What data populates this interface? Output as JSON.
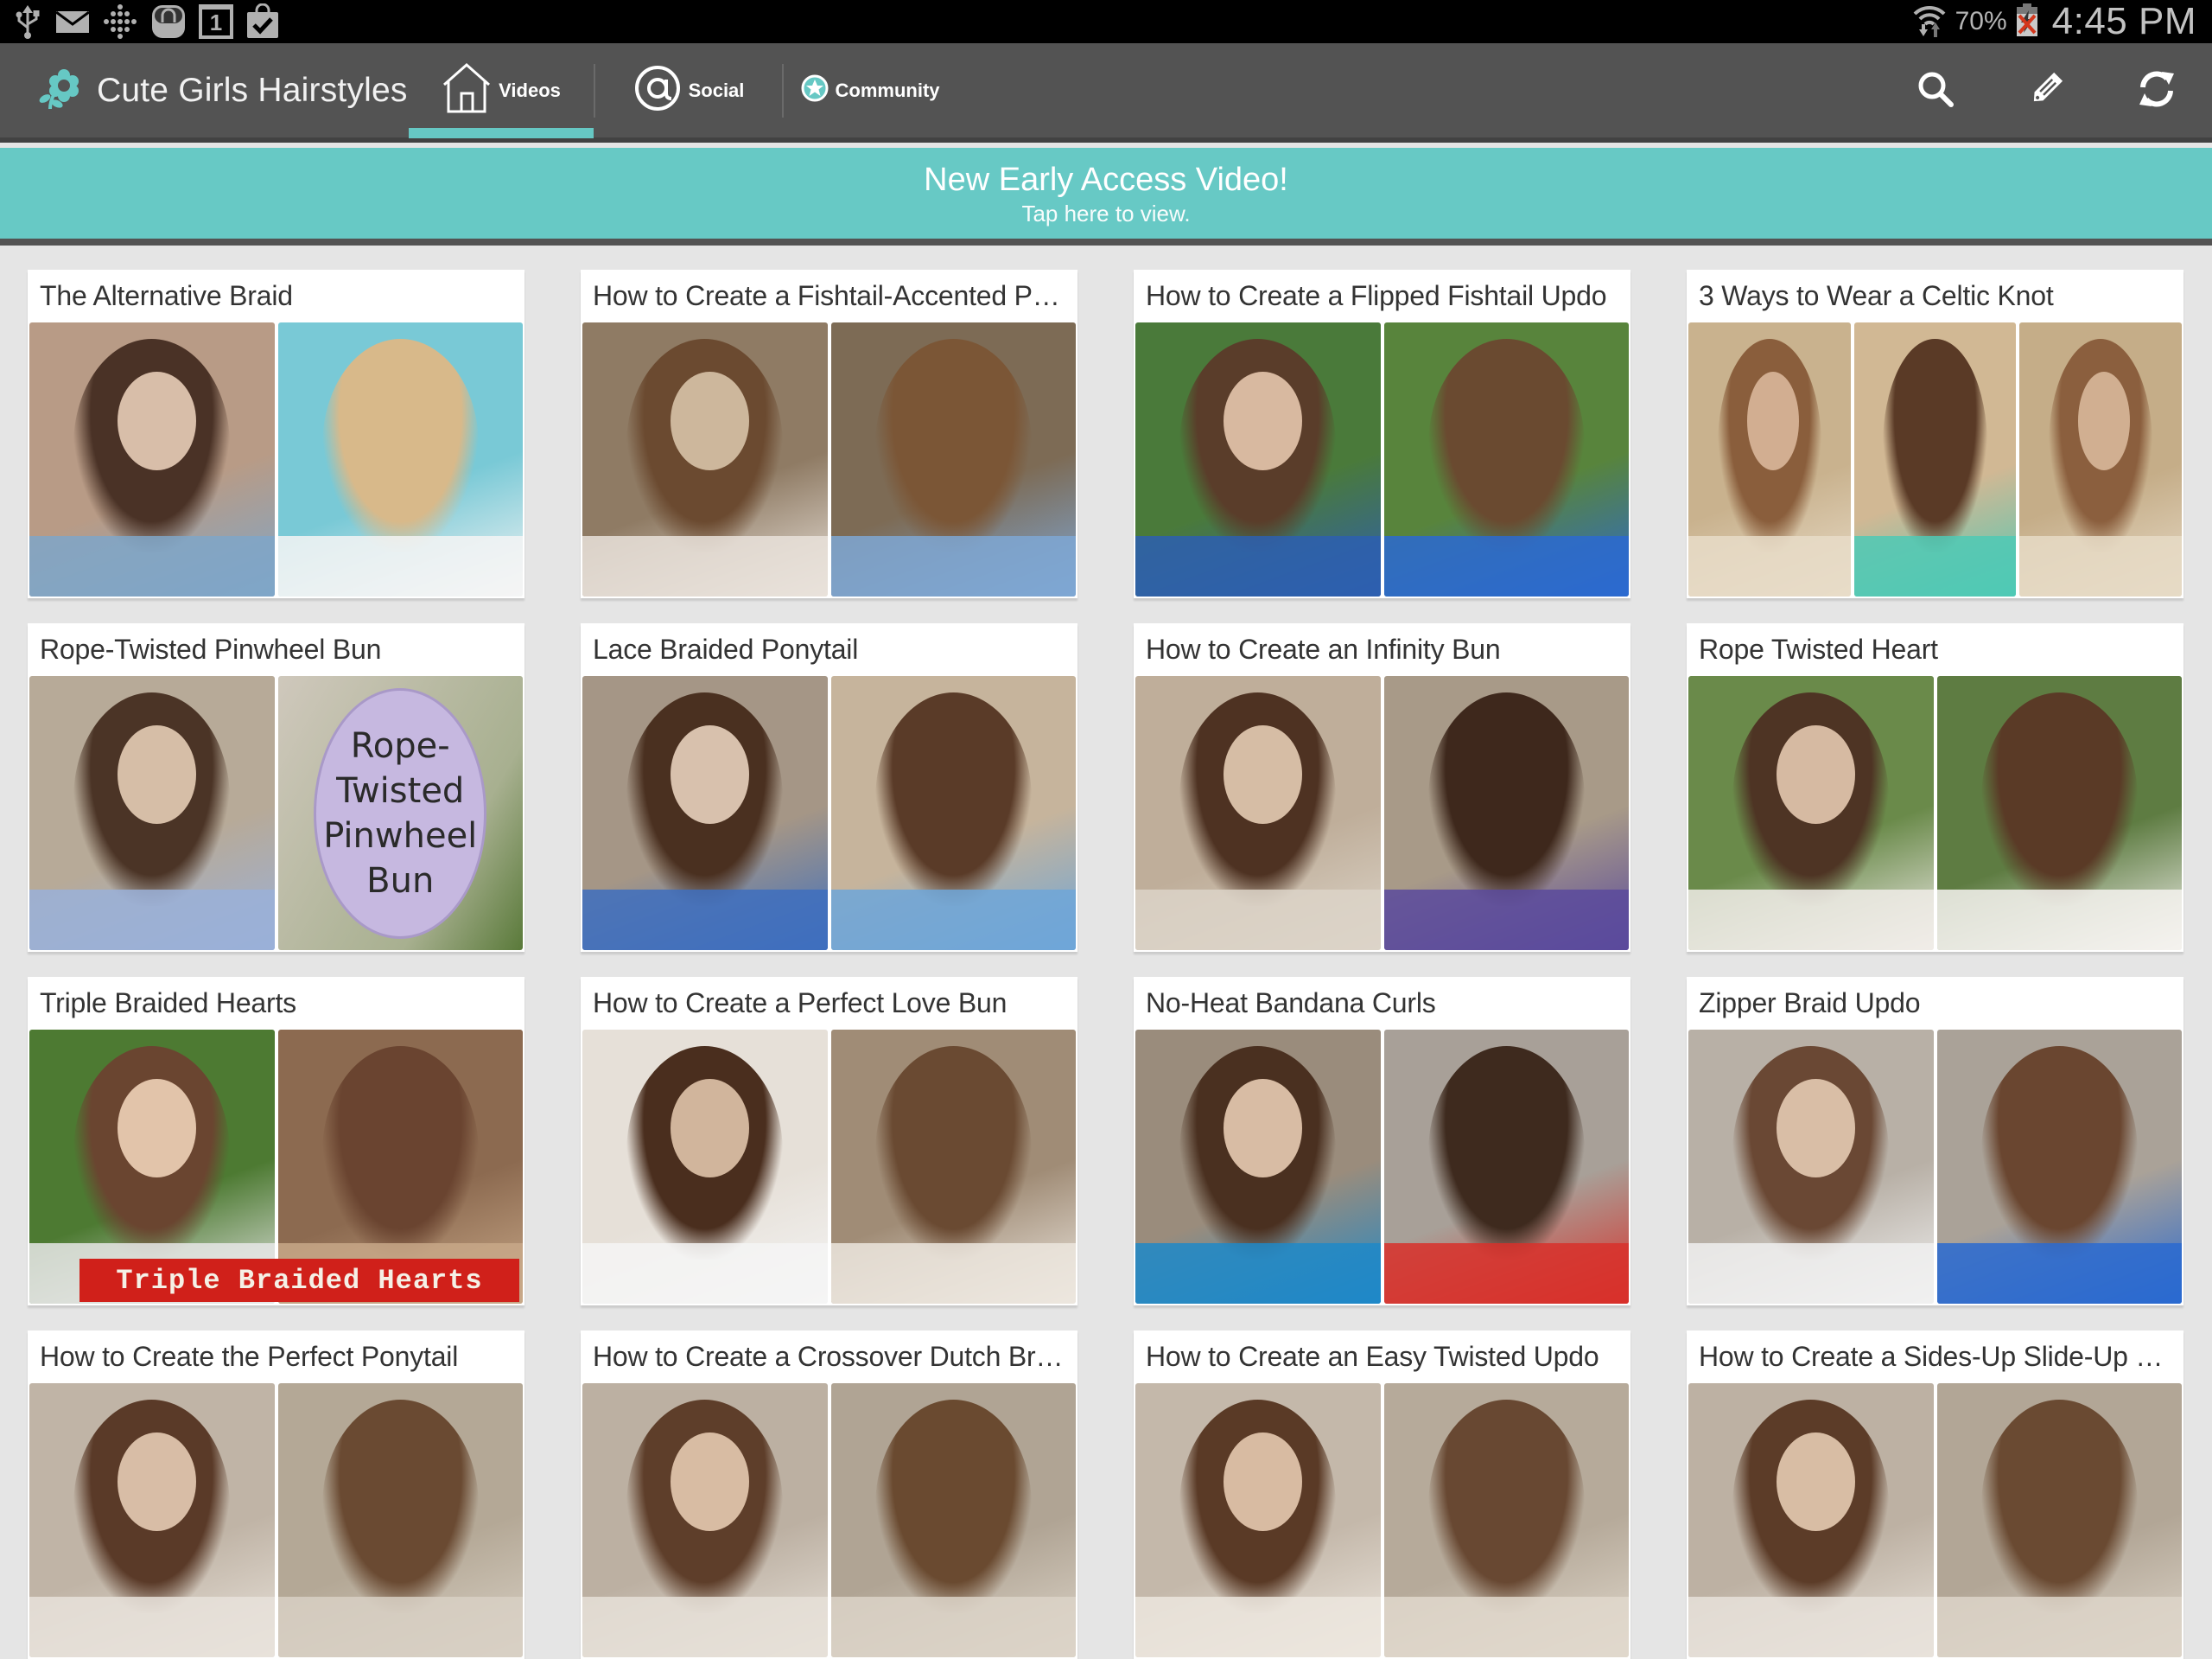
{
  "status_bar": {
    "left_icons": [
      "usb-icon",
      "mail-icon",
      "dots-grid-icon",
      "shopping-bag-icon",
      "calendar-icon",
      "task-check-icon"
    ],
    "calendar_day": "1",
    "battery_percent": "70%",
    "time": "4:45 PM"
  },
  "action_bar": {
    "app_title": "Cute Girls Hairstyles",
    "tabs": [
      {
        "label": "Videos",
        "icon": "home-icon",
        "active": true
      },
      {
        "label": "Social",
        "icon": "at-sign-icon",
        "active": false
      },
      {
        "label": "Community",
        "icon": "star-badge-icon",
        "active": false
      }
    ],
    "actions": [
      "search-icon",
      "tag-icon",
      "refresh-icon"
    ]
  },
  "banner": {
    "title": "New Early Access Video!",
    "subtitle": "Tap here to view."
  },
  "colors": {
    "accent": "#66c8c4",
    "action_bar": "#535353",
    "background": "#e5e5e5"
  },
  "videos": [
    {
      "title": "The Alternative Braid",
      "thumbs": 2
    },
    {
      "title": "How to Create a Fishtail-Accented Po...",
      "thumbs": 2
    },
    {
      "title": "How to Create a Flipped Fishtail Updo",
      "thumbs": 2
    },
    {
      "title": "3 Ways to Wear a Celtic Knot",
      "thumbs": 3
    },
    {
      "title": "Rope-Twisted Pinwheel Bun",
      "thumbs": 2,
      "overlay_text": [
        "Rope-",
        "Twisted",
        "Pinwheel",
        "Bun"
      ]
    },
    {
      "title": "Lace Braided Ponytail",
      "thumbs": 2
    },
    {
      "title": "How to Create an Infinity Bun",
      "thumbs": 2
    },
    {
      "title": "Rope Twisted Heart",
      "thumbs": 2
    },
    {
      "title": "Triple Braided Hearts",
      "thumbs": 2,
      "banner_text": "Triple Braided Hearts"
    },
    {
      "title": "How to Create a Perfect Love Bun",
      "thumbs": 2
    },
    {
      "title": "No-Heat Bandana Curls",
      "thumbs": 2
    },
    {
      "title": "Zipper Braid Updo",
      "thumbs": 2
    },
    {
      "title": "How to Create the Perfect Ponytail",
      "thumbs": 2
    },
    {
      "title": "How to Create a Crossover Dutch Braid",
      "thumbs": 2
    },
    {
      "title": "How to Create an Easy Twisted Updo",
      "thumbs": 2
    },
    {
      "title": "How to Create a Sides-Up Slide-Up H...",
      "thumbs": 2
    }
  ]
}
